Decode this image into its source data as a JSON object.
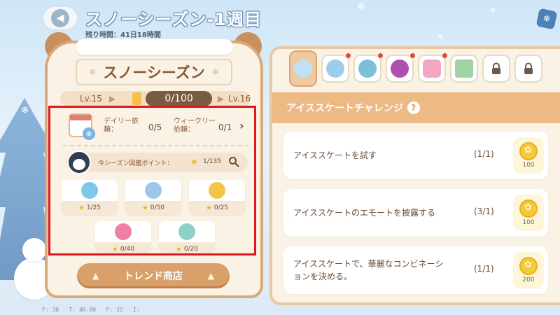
{
  "header": {
    "title": "スノーシーズン-1週目",
    "remaining": "残り時間：41日18時間",
    "back_icon": "chevron-left-icon"
  },
  "season": {
    "name": "スノーシーズン",
    "level_current": "Lv.15",
    "level_next": "Lv.16",
    "progress_text": "0/100",
    "progress_fraction": 0.0
  },
  "requests": {
    "daily_label": "デイリー依頼：",
    "daily_value": "0/5",
    "weekly_label": "ウィークリー依頼：",
    "weekly_value": "0/1"
  },
  "points": {
    "label": "今シーズン図鑑ポイント：",
    "value": "1/135"
  },
  "tiles": [
    {
      "icon": "fish-icon",
      "value": "1/25",
      "color": "#7ec7e8"
    },
    {
      "icon": "bowl-icon",
      "value": "0/50",
      "color": "#9fc6ea"
    },
    {
      "icon": "butterfly-icon",
      "value": "0/25",
      "color": "#f2c548"
    },
    {
      "icon": "donut-icon",
      "value": "0/40",
      "color": "#f07fa8"
    },
    {
      "icon": "bird-icon",
      "value": "0/20",
      "color": "#8fd0c9"
    }
  ],
  "shop_button": "トレンド商店",
  "tabs": [
    {
      "icon": "ice-skate-icon",
      "active": true,
      "dot": false
    },
    {
      "icon": "hot-pot-icon",
      "active": false,
      "dot": true
    },
    {
      "icon": "fishing-icon",
      "active": false,
      "dot": true
    },
    {
      "icon": "record-icon",
      "active": false,
      "dot": true
    },
    {
      "icon": "snowman-card-icon",
      "active": false,
      "dot": true
    },
    {
      "icon": "photo-frame-icon",
      "active": false,
      "dot": false
    },
    {
      "icon": "lock-icon",
      "active": false,
      "dot": false
    },
    {
      "icon": "lock-icon",
      "active": false,
      "dot": false
    }
  ],
  "challenge": {
    "title": "アイススケートチャレンジ"
  },
  "tasks": [
    {
      "name": "アイススケートを試す",
      "count": "(1/1)",
      "reward": "100"
    },
    {
      "name": "アイススケートのエモートを披露する",
      "count": "(3/1)",
      "reward": "100"
    },
    {
      "name_line1": "アイススケートで、華麗なコンビネーシ",
      "name_line2": "ョンを決める。",
      "count": "(1/1)",
      "reward": "200"
    }
  ]
}
